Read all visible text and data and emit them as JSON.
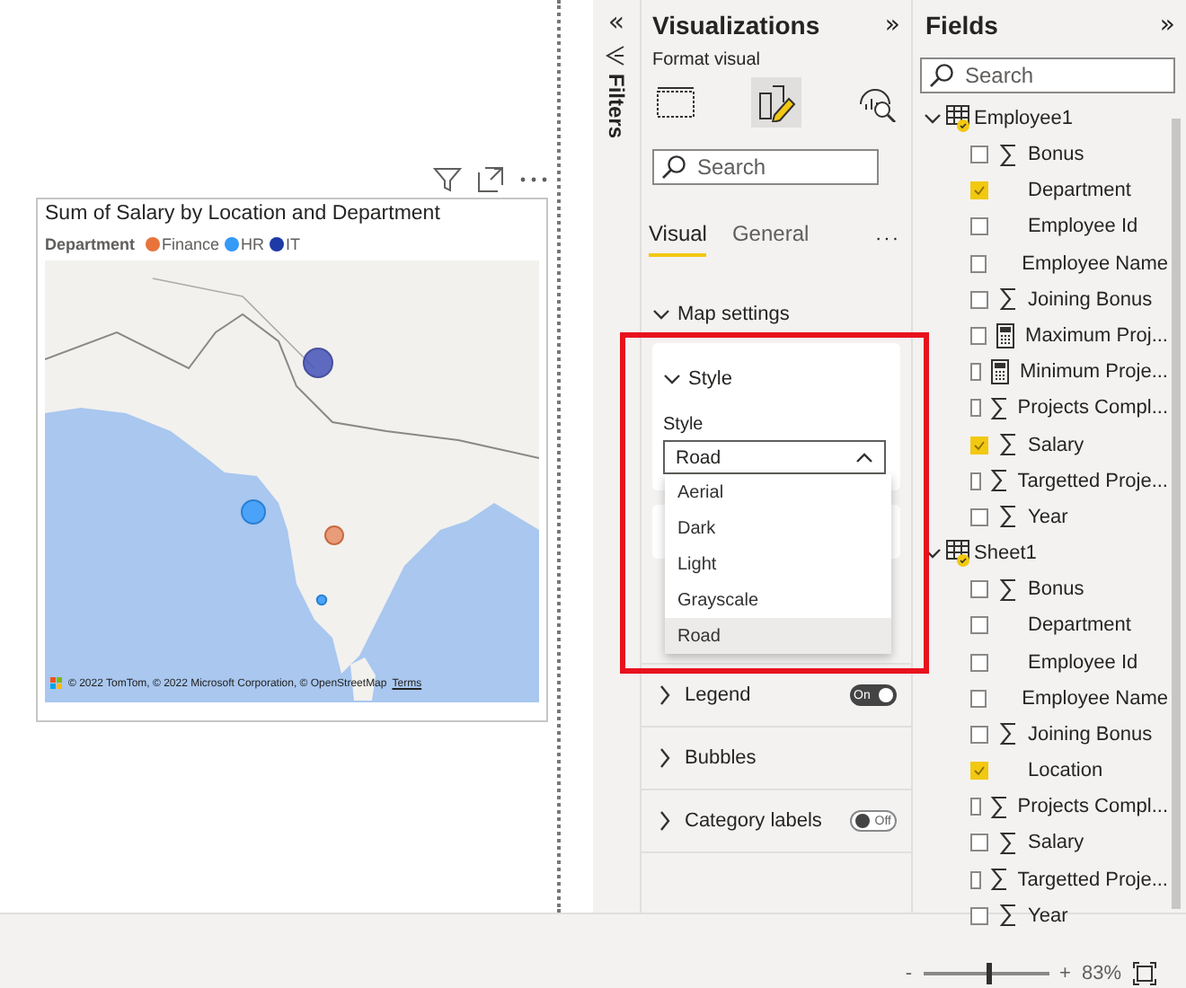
{
  "canvas": {
    "visual": {
      "title": "Sum of Salary by Location and Department",
      "legend_title": "Department",
      "legend": [
        {
          "label": "Finance",
          "color": "#e8743b"
        },
        {
          "label": "HR",
          "color": "#3599f6"
        },
        {
          "label": "IT",
          "color": "#1d3aa6"
        }
      ],
      "attribution": "© 2022 TomTom, © 2022 Microsoft Corporation, © OpenStreetMap",
      "terms": "Terms"
    }
  },
  "filters": {
    "collapse": "«",
    "label": "Filters"
  },
  "visualizations": {
    "title": "Visualizations",
    "expand": "»",
    "subtitle": "Format visual",
    "search_placeholder": "Search",
    "tabs": [
      {
        "label": "Visual",
        "selected": true
      },
      {
        "label": "General",
        "selected": false
      }
    ],
    "more": "···",
    "section": {
      "label": "Map settings",
      "expanded": true
    },
    "style_card": {
      "label": "Style",
      "expanded": true,
      "field_label": "Style",
      "value": "Road"
    },
    "dropdown": [
      {
        "label": "Aerial",
        "selected": false
      },
      {
        "label": "Dark",
        "selected": false
      },
      {
        "label": "Light",
        "selected": false
      },
      {
        "label": "Grayscale",
        "selected": false
      },
      {
        "label": "Road",
        "selected": true
      }
    ],
    "sections": [
      {
        "label": "Legend",
        "kind": "toggle",
        "on": true,
        "toggle_text": "On"
      },
      {
        "label": "Bubbles",
        "kind": "plain"
      },
      {
        "label": "Category labels",
        "kind": "toggle",
        "on": false,
        "toggle_text": "Off"
      }
    ]
  },
  "fields": {
    "title": "Fields",
    "expand": "»",
    "search_placeholder": "Search",
    "tables": [
      {
        "name": "Employee1",
        "expanded": true,
        "children": [
          {
            "name": "Bonus",
            "kind": "sum",
            "checked": false
          },
          {
            "name": "Department",
            "kind": "text",
            "checked": true
          },
          {
            "name": "Employee Id",
            "kind": "text",
            "checked": false
          },
          {
            "name": "Employee Name",
            "kind": "text",
            "checked": false
          },
          {
            "name": "Joining Bonus",
            "kind": "sum",
            "checked": false
          },
          {
            "name": "Maximum Proj...",
            "kind": "measure",
            "checked": false
          },
          {
            "name": "Minimum Proje...",
            "kind": "measure",
            "checked": false
          },
          {
            "name": "Projects Compl...",
            "kind": "sum",
            "checked": false
          },
          {
            "name": "Salary",
            "kind": "sum",
            "checked": true
          },
          {
            "name": "Targetted Proje...",
            "kind": "sum",
            "checked": false
          },
          {
            "name": "Year",
            "kind": "sum",
            "checked": false
          }
        ]
      },
      {
        "name": "Sheet1",
        "expanded": true,
        "children": [
          {
            "name": "Bonus",
            "kind": "sum",
            "checked": false
          },
          {
            "name": "Department",
            "kind": "text",
            "checked": false
          },
          {
            "name": "Employee Id",
            "kind": "text",
            "checked": false
          },
          {
            "name": "Employee Name",
            "kind": "text",
            "checked": false
          },
          {
            "name": "Joining Bonus",
            "kind": "sum",
            "checked": false
          },
          {
            "name": "Location",
            "kind": "text",
            "checked": true
          },
          {
            "name": "Projects Compl...",
            "kind": "sum",
            "checked": false
          },
          {
            "name": "Salary",
            "kind": "sum",
            "checked": false
          },
          {
            "name": "Targetted Proje...",
            "kind": "sum",
            "checked": false
          },
          {
            "name": "Year",
            "kind": "sum",
            "checked": false
          }
        ]
      }
    ]
  },
  "status_bar": {
    "minus": "-",
    "plus": "+",
    "zoom": {
      "level": 0.5
    },
    "zoom_text": "83%"
  }
}
